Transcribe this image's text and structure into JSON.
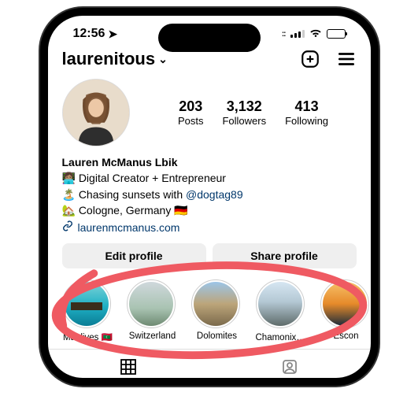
{
  "status_bar": {
    "time": "12:56"
  },
  "header": {
    "username": "laurenitous"
  },
  "profile": {
    "stats": {
      "posts": {
        "value": "203",
        "label": "Posts"
      },
      "followers": {
        "value": "3,132",
        "label": "Followers"
      },
      "following": {
        "value": "413",
        "label": "Following"
      }
    },
    "display_name": "Lauren McManus Lbik",
    "bio_line_1": "👩🏽‍💻 Digital Creator + Entrepreneur",
    "bio_line_2_prefix": "🏝️ Chasing sunsets with ",
    "bio_line_2_mention": "@dogtag89",
    "bio_line_3": "🏡 Cologne, Germany 🇩🇪",
    "website": "laurenmcmanus.com"
  },
  "buttons": {
    "edit": "Edit profile",
    "share": "Share profile"
  },
  "highlights": [
    {
      "label": "Maldives 🇲🇻"
    },
    {
      "label": "Switzerland"
    },
    {
      "label": "Dolomites"
    },
    {
      "label": "Chamonix 🏔️"
    },
    {
      "label": "Escon"
    }
  ]
}
